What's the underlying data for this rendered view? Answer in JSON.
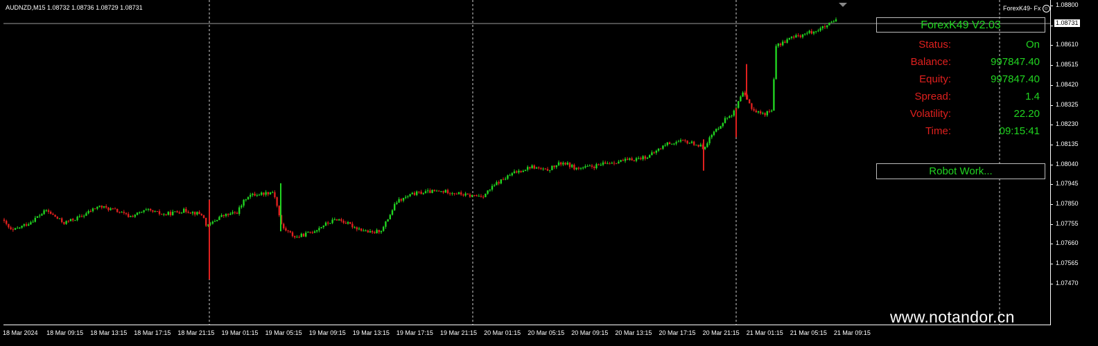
{
  "header": {
    "symbol": "AUDNZD,M15",
    "ohlc": "1.08732 1.08736 1.08729 1.08731"
  },
  "ea_badge": {
    "label": "ForexK49- Fx",
    "face": "☺"
  },
  "panel": {
    "title": "ForexK49  V2.03",
    "rows": [
      {
        "key": "Status:",
        "value": "On"
      },
      {
        "key": "Balance:",
        "value": "997847.40"
      },
      {
        "key": "Equity:",
        "value": "997847.40"
      },
      {
        "key": "Spread:",
        "value": "1.4"
      },
      {
        "key": "Volatility:",
        "value": "22.20"
      },
      {
        "key": "Time:",
        "value": "09:15:41"
      }
    ],
    "button_label": "Robot Work..."
  },
  "watermark": "www.notandor.cn",
  "price_axis": {
    "ticks": [
      "1.08800",
      "1.08705",
      "1.08610",
      "1.08515",
      "1.08420",
      "1.08325",
      "1.08230",
      "1.08135",
      "1.08040",
      "1.07945",
      "1.07850",
      "1.07755",
      "1.07660",
      "1.07565",
      "1.07470"
    ],
    "current": "1.08731"
  },
  "time_axis": {
    "ticks": [
      "18 Mar 2024",
      "18 Mar 09:15",
      "18 Mar 13:15",
      "18 Mar 17:15",
      "18 Mar 21:15",
      "19 Mar 01:15",
      "19 Mar 05:15",
      "19 Mar 09:15",
      "19 Mar 13:15",
      "19 Mar 17:15",
      "19 Mar 21:15",
      "20 Mar 01:15",
      "20 Mar 05:15",
      "20 Mar 09:15",
      "20 Mar 13:15",
      "20 Mar 17:15",
      "20 Mar 21:15",
      "21 Mar 01:15",
      "21 Mar 05:15",
      "21 Mar 09:15"
    ]
  },
  "colors": {
    "bull": "#21d421",
    "bear": "#e0201e",
    "background": "#000000",
    "grid": "#ffffff"
  },
  "chart_data": {
    "type": "candlestick",
    "symbol": "AUDNZD",
    "timeframe": "M15",
    "ylim": [
      1.0747,
      1.088
    ],
    "period_separators": [
      "18 Mar 22:00",
      "19 Mar 22:00",
      "20 Mar 22:00"
    ],
    "path": [
      [
        0,
        1.078
      ],
      [
        20,
        1.0772
      ],
      [
        45,
        1.0776
      ],
      [
        70,
        1.0782
      ],
      [
        95,
        1.0776
      ],
      [
        120,
        1.0779
      ],
      [
        145,
        1.0784
      ],
      [
        170,
        1.0782
      ],
      [
        190,
        1.0779
      ],
      [
        215,
        1.0782
      ],
      [
        240,
        1.078
      ],
      [
        270,
        1.0782
      ],
      [
        295,
        1.078
      ],
      [
        302,
        1.0774
      ],
      [
        320,
        1.0779
      ],
      [
        345,
        1.0781
      ],
      [
        360,
        1.0789
      ],
      [
        380,
        1.079
      ],
      [
        398,
        1.0791
      ],
      [
        410,
        1.0774
      ],
      [
        430,
        1.0769
      ],
      [
        455,
        1.0772
      ],
      [
        470,
        1.0775
      ],
      [
        490,
        1.0778
      ],
      [
        515,
        1.0774
      ],
      [
        540,
        1.0771
      ],
      [
        555,
        1.0773
      ],
      [
        575,
        1.0786
      ],
      [
        600,
        1.079
      ],
      [
        625,
        1.0791
      ],
      [
        650,
        1.0791
      ],
      [
        680,
        1.0789
      ],
      [
        700,
        1.0789
      ],
      [
        720,
        1.0795
      ],
      [
        745,
        1.08
      ],
      [
        770,
        1.0803
      ],
      [
        790,
        1.0801
      ],
      [
        815,
        1.0805
      ],
      [
        835,
        1.0802
      ],
      [
        860,
        1.0803
      ],
      [
        885,
        1.0805
      ],
      [
        910,
        1.0806
      ],
      [
        940,
        1.0808
      ],
      [
        965,
        1.0814
      ],
      [
        990,
        1.0815
      ],
      [
        1005,
        1.0814
      ],
      [
        1018,
        1.0812
      ],
      [
        1030,
        1.0818
      ],
      [
        1050,
        1.0826
      ],
      [
        1062,
        1.0829
      ],
      [
        1075,
        1.0838
      ],
      [
        1090,
        1.083
      ],
      [
        1105,
        1.0828
      ],
      [
        1117,
        1.083
      ],
      [
        1122,
        1.086
      ],
      [
        1140,
        1.0864
      ],
      [
        1160,
        1.0866
      ],
      [
        1180,
        1.0868
      ],
      [
        1195,
        1.087
      ],
      [
        1210,
        1.0873
      ]
    ]
  }
}
